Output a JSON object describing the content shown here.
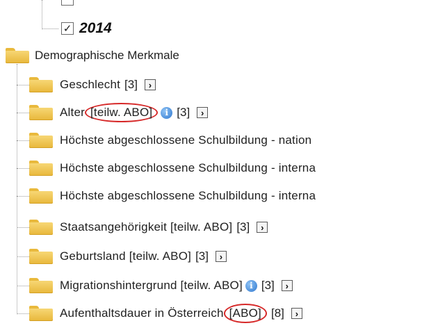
{
  "year_item": {
    "label": "2014",
    "checked": true,
    "check_glyph": "✓"
  },
  "root": {
    "label": "Demographische Merkmale"
  },
  "items": [
    {
      "label": "Geschlecht",
      "annotation": "",
      "info": false,
      "count": "[3]"
    },
    {
      "label": "Alter",
      "annotation": "[teilw. ABO]",
      "info": true,
      "count": "[3]"
    },
    {
      "label": "Höchste abgeschlossene Schulbildung - nation",
      "annotation": "",
      "info": false,
      "count": ""
    },
    {
      "label": "Höchste abgeschlossene Schulbildung - interna",
      "annotation": "",
      "info": false,
      "count": ""
    },
    {
      "label": "Höchste abgeschlossene Schulbildung - interna",
      "annotation": "",
      "info": false,
      "count": ""
    },
    {
      "label": "Staatsangehörigkeit [teilw. ABO]",
      "annotation": "",
      "info": false,
      "count": "[3]"
    },
    {
      "label": "Geburtsland [teilw. ABO]",
      "annotation": "",
      "info": false,
      "count": "[3]"
    },
    {
      "label": "Migrationshintergrund [teilw. ABO]",
      "annotation": "",
      "info": true,
      "count": "[3]"
    },
    {
      "label": "Aufenthaltsdauer in Österreich",
      "annotation": "[ABO]",
      "info": false,
      "count": "[8]"
    }
  ],
  "icons": {
    "expand": "›",
    "info": "i"
  },
  "colors": {
    "folder": "#f2c14e",
    "highlight": "#d62828",
    "info": "#2f78cf"
  }
}
